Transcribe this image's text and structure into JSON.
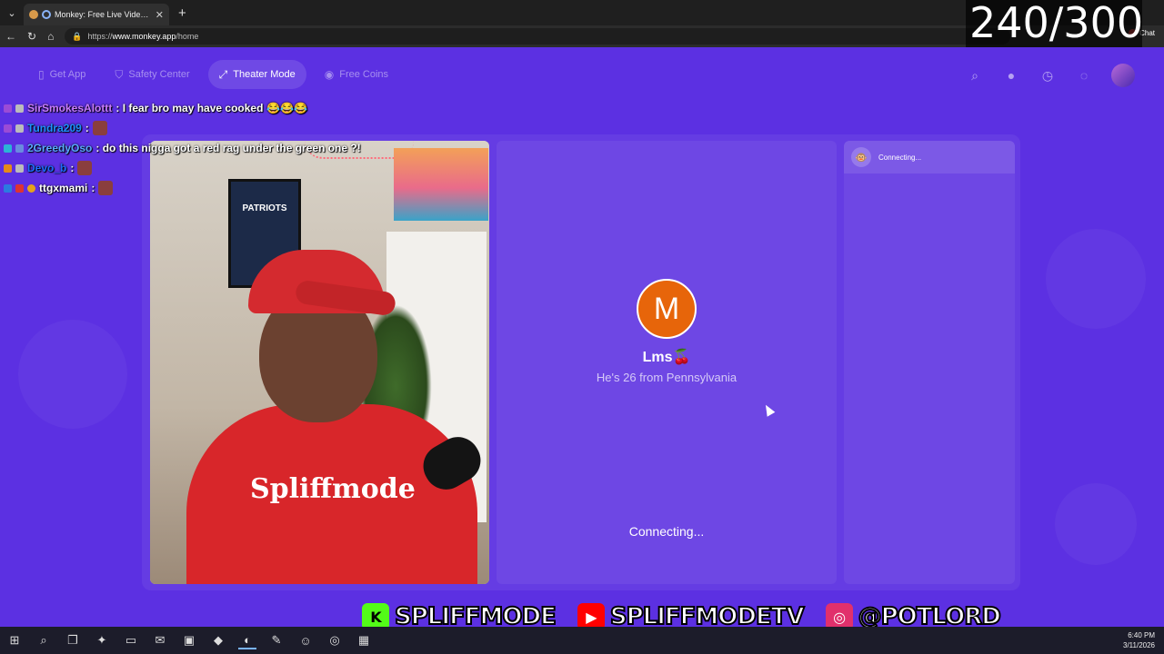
{
  "browser": {
    "tab_title": "Monkey: Free Live Video Chat",
    "url_prefix": "https://",
    "url_host": "www.monkey.app",
    "url_path": "/home",
    "chat_label": "Chat"
  },
  "overlay": {
    "counter": "240/300"
  },
  "nav": {
    "items": [
      {
        "label": "Get App"
      },
      {
        "label": "Safety Center"
      },
      {
        "label": "Theater Mode"
      },
      {
        "label": "Free Coins"
      }
    ]
  },
  "chat": {
    "lines": [
      {
        "user": "SirSmokesAlottt",
        "color": "#c97cff",
        "message": ": I fear bro may have cooked",
        "emoji": "😂😂😂"
      },
      {
        "user": "Tundra209",
        "color": "#1e90ff",
        "message": ":",
        "emoji": ""
      },
      {
        "user": "2GreedyOso",
        "color": "#5aa8ff",
        "message": ": do this nigga got a red rag under the green one ?!",
        "emoji": ""
      },
      {
        "user": "Devo_b",
        "color": "#1e6bff",
        "message": ":",
        "emoji": ""
      },
      {
        "user": "ttgxmami",
        "color": "#ffffff",
        "message": ":",
        "emoji": ""
      }
    ]
  },
  "camera": {
    "poster_text": "PATRIOTS",
    "hoodie_text": "Spliffmode"
  },
  "partner": {
    "initial": "M",
    "name": "Lms",
    "name_emoji": "🍒",
    "bio": "He's 26 from Pennsylvania",
    "status": "Connecting..."
  },
  "side_panel": {
    "status": "Connecting...",
    "icon": "🐵"
  },
  "socials": [
    {
      "platform": "kick",
      "handle": "SPLIFFMODE",
      "logo": "K",
      "color": "#53fc18"
    },
    {
      "platform": "youtube",
      "handle": "SPLIFFMODETV",
      "logo": "▶",
      "color": "#ff0000"
    },
    {
      "platform": "instagram",
      "handle": "@POTLORD",
      "logo": "◎",
      "color": "#e1306c"
    }
  ],
  "taskbar": {
    "time": "6:40 PM",
    "date": "3/11/2026"
  }
}
